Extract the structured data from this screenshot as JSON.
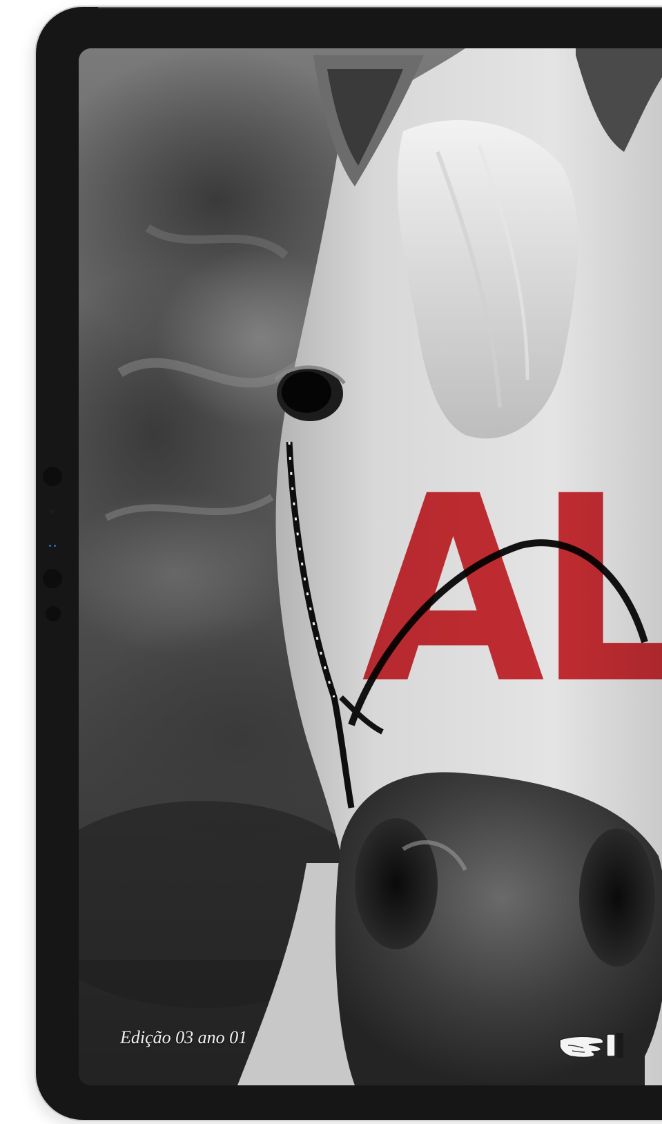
{
  "cover": {
    "title": "AL",
    "edition": "Edição 03 ano 01"
  },
  "icons": {
    "next": "pointing-hand-icon"
  },
  "colors": {
    "title_red": "#d41f26",
    "bezel": "#161616",
    "frame": "#cfd0d2"
  }
}
